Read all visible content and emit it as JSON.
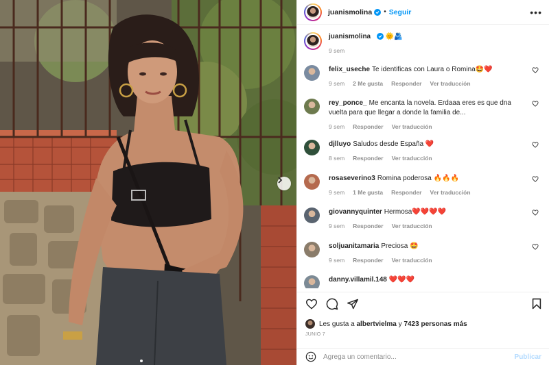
{
  "post": {
    "username": "juanismolina",
    "follow_label": "Seguir",
    "separator": "•",
    "more_label": "•••",
    "caption_emojis": "🌞🫂",
    "caption_time": "9 sem"
  },
  "comments": [
    {
      "user": "felix_useche",
      "text": "Te identificas con Laura o Romina🤩❤️",
      "time": "9 sem",
      "likes": "2 Me gusta",
      "reply": "Responder",
      "translate": "Ver traducción",
      "avatar": "#7a8ba0"
    },
    {
      "user": "rey_ponce_",
      "text": "Me encanta la novela. Erdaaa eres es que dna vuelta para que llegar a donde la familia de...",
      "time": "9 sem",
      "likes": "",
      "reply": "Responder",
      "translate": "Ver traducción",
      "avatar": "#6d7a4e"
    },
    {
      "user": "djlluyo",
      "text": "Saludos desde España ❤️",
      "time": "8 sem",
      "likes": "",
      "reply": "Responder",
      "translate": "Ver traducción",
      "avatar": "#2f4f3a"
    },
    {
      "user": "rosaseverino3",
      "text": "Romina poderosa 🔥🔥🔥",
      "time": "9 sem",
      "likes": "1 Me gusta",
      "reply": "Responder",
      "translate": "Ver traducción",
      "avatar": "#b56a4e"
    },
    {
      "user": "giovannyquinter",
      "text": "Hermosa❤️❤️❤️❤️",
      "time": "9 sem",
      "likes": "",
      "reply": "Responder",
      "translate": "Ver traducción",
      "avatar": "#5a6470"
    },
    {
      "user": "soljuanitamaria",
      "text": "Preciosa 🤩",
      "time": "9 sem",
      "likes": "",
      "reply": "Responder",
      "translate": "Ver traducción",
      "avatar": "#8a7c6a"
    },
    {
      "user": "danny.villamil.148",
      "text": "❤️❤️❤️",
      "time": "",
      "likes": "",
      "reply": "",
      "translate": "",
      "avatar": "#7c8a95"
    }
  ],
  "likes": {
    "prefix": "Les gusta a",
    "user": "albertvielma",
    "middle": "y",
    "count": "7423 personas más"
  },
  "date": "JUNIO 7",
  "add_comment": {
    "placeholder": "Agrega un comentario...",
    "publish_label": "Publicar"
  },
  "colors": {
    "accent": "#0095f6",
    "like_red": "#ed4956",
    "muted": "#8e8e8e"
  }
}
